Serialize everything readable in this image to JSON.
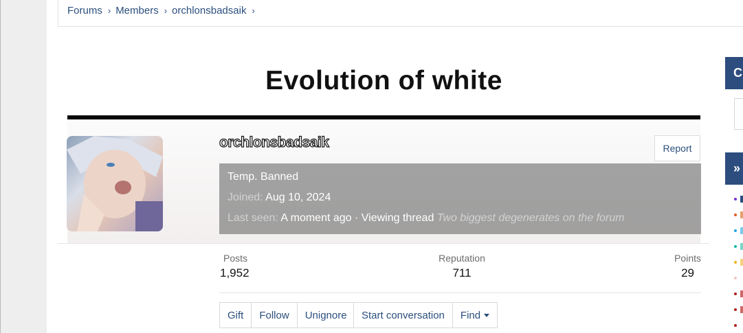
{
  "breadcrumb": {
    "items": [
      "Forums",
      "Members",
      "orchlonsbadsaik"
    ]
  },
  "banner": {
    "title": "Evolution of white"
  },
  "profile": {
    "username": "orchlonsbadsaik",
    "report_label": "Report",
    "status": "Temp. Banned",
    "joined_label": "Joined:",
    "joined_value": "Aug 10, 2024",
    "last_seen_label": "Last seen:",
    "last_seen_value": "A moment ago",
    "activity": "· Viewing thread",
    "activity_thread": "Two biggest degenerates on the forum"
  },
  "stats": {
    "posts_label": "Posts",
    "posts_value": "1,952",
    "reputation_label": "Reputation",
    "reputation_value": "711",
    "points_label": "Points",
    "points_value": "29"
  },
  "actions": {
    "gift": "Gift",
    "follow": "Follow",
    "unignore": "Unignore",
    "start_conversation": "Start conversation",
    "find": "Find"
  },
  "sidebar": {
    "tab1_glyph": "C",
    "tab2_glyph": "»"
  },
  "colors": {
    "accent": "#2c4d7e",
    "link": "#2b4f7d"
  }
}
